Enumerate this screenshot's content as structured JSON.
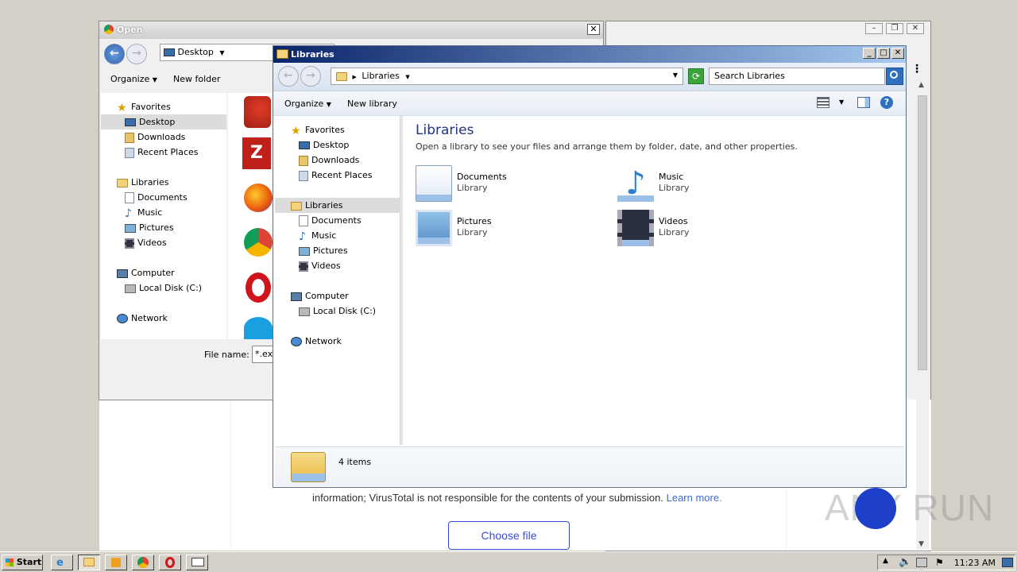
{
  "browser": {
    "info_text": "information; VirusTotal is not responsible for the contents of your submission.",
    "learn_more": "Learn more.",
    "choose_file": "Choose file"
  },
  "open_dialog": {
    "title": "Open",
    "path": "Desktop",
    "toolbar": {
      "organize": "Organize",
      "new_folder": "New folder"
    },
    "nav": {
      "favorites": "Favorites",
      "desktop": "Desktop",
      "downloads": "Downloads",
      "recent_places": "Recent Places",
      "libraries": "Libraries",
      "documents": "Documents",
      "music": "Music",
      "pictures": "Pictures",
      "videos": "Videos",
      "computer": "Computer",
      "local_disk": "Local Disk (C:)",
      "network": "Network"
    },
    "file_name_label": "File name:",
    "file_name_value": "*.exe"
  },
  "libraries_window": {
    "title": "Libraries",
    "path": "Libraries",
    "search_placeholder": "Search Libraries",
    "toolbar": {
      "organize": "Organize",
      "new_library": "New library"
    },
    "nav": {
      "favorites": "Favorites",
      "desktop": "Desktop",
      "downloads": "Downloads",
      "recent_places": "Recent Places",
      "libraries": "Libraries",
      "documents": "Documents",
      "music": "Music",
      "pictures": "Pictures",
      "videos": "Videos",
      "computer": "Computer",
      "local_disk": "Local Disk (C:)",
      "network": "Network"
    },
    "heading": "Libraries",
    "subheading": "Open a library to see your files and arrange them by folder, date, and other properties.",
    "items": [
      {
        "name": "Documents",
        "type": "Library"
      },
      {
        "name": "Music",
        "type": "Library"
      },
      {
        "name": "Pictures",
        "type": "Library"
      },
      {
        "name": "Videos",
        "type": "Library"
      }
    ],
    "status": "4 items"
  },
  "taskbar": {
    "start": "Start",
    "clock": "11:23 AM"
  },
  "watermark": "ANY RUN"
}
